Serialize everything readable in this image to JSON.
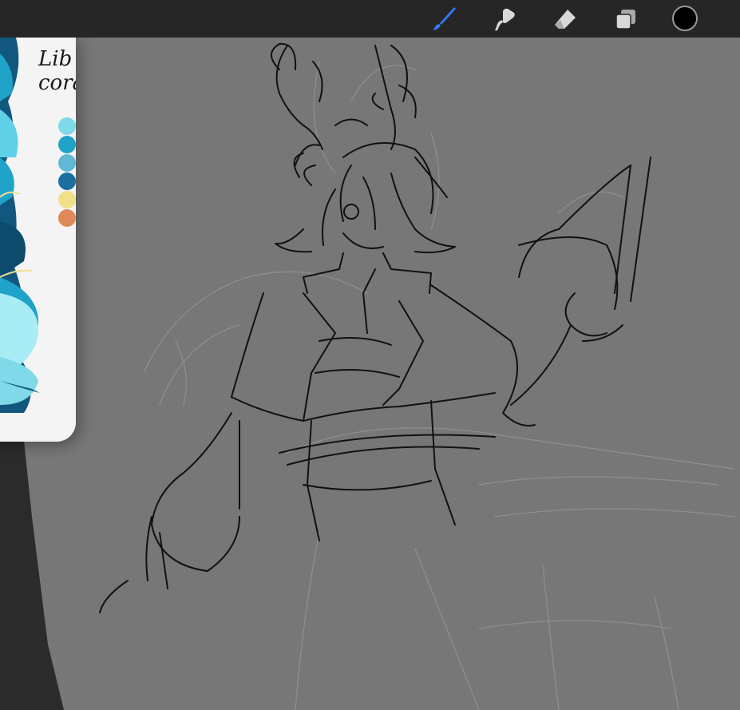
{
  "app": {
    "toolbar": {
      "tools": [
        {
          "name": "brush",
          "active": true
        },
        {
          "name": "smudge",
          "active": false
        },
        {
          "name": "eraser",
          "active": false
        },
        {
          "name": "layers",
          "active": false
        }
      ],
      "current_color": "#000000",
      "active_tool_color": "#2f7cf6"
    },
    "reference": {
      "note_text": "Lib\ncora",
      "palette_colors": [
        "#7fd9e8",
        "#1fa3c8",
        "#5fb9d4",
        "#1a6fa0",
        "#f0e08a",
        "#e08a5a"
      ]
    },
    "canvas": {
      "background": "#777777",
      "stroke_color": "#111111",
      "sketch_color": "#8c8c8c"
    }
  }
}
